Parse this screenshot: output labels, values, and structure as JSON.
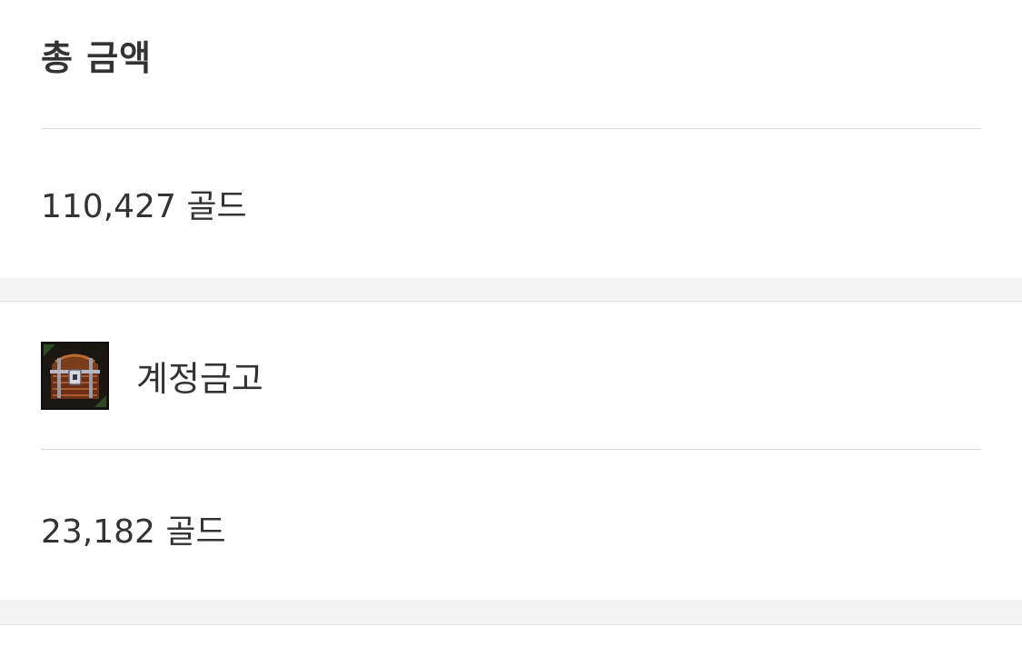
{
  "total": {
    "title": "총 금액",
    "amount": "110,427",
    "unit": "골드"
  },
  "vault": {
    "icon": "treasure-chest-icon",
    "title": "계정금고",
    "amount": "23,182",
    "unit": "골드"
  },
  "colors": {
    "text": "#333333",
    "divider": "#dddddd",
    "section_gap": "#f4f4f4"
  }
}
